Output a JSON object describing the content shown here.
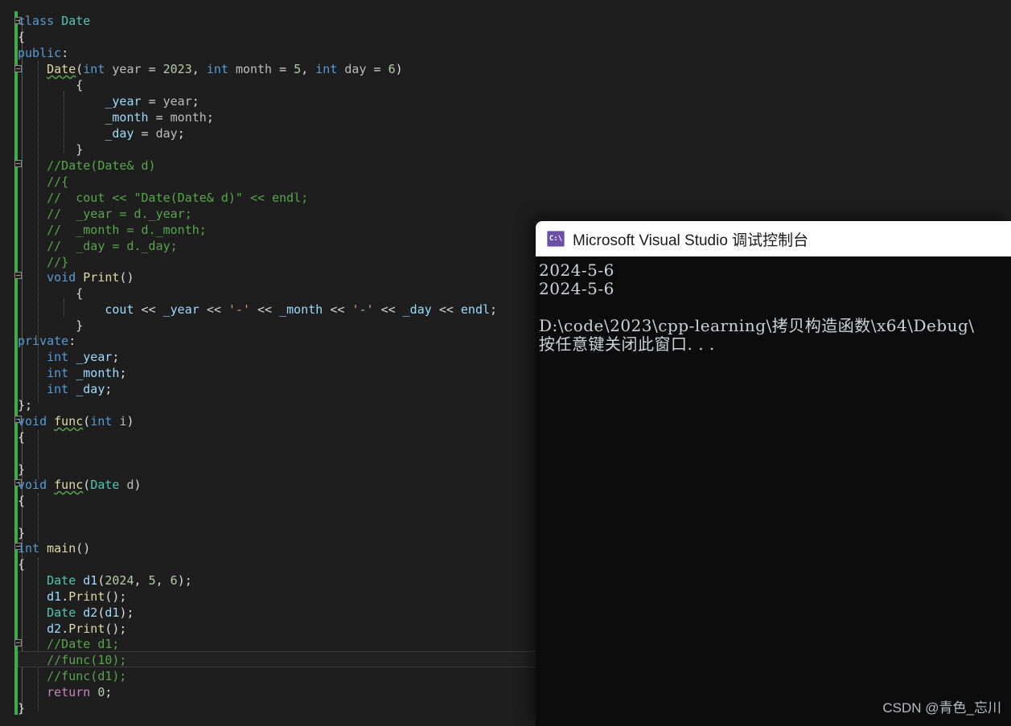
{
  "editor": {
    "background": "#1e1e1e",
    "change_bar_color": "#3fae49",
    "current_line": "//func(10);",
    "lines": [
      "class Date",
      "{",
      "public:",
      "    Date(int year = 2023, int month = 5, int day = 6)",
      "    {",
      "        _year = year;",
      "        _month = month;",
      "        _day = day;",
      "    }",
      "    //Date(Date& d)",
      "    //{",
      "    //  cout << \"Date(Date& d)\" << endl;",
      "    //  _year = d._year;",
      "    //  _month = d._month;",
      "    //  _day = d._day;",
      "    //}",
      "    void Print()",
      "    {",
      "        cout << _year << '-' << _month << '-' << _day << endl;",
      "    }",
      "private:",
      "    int _year;",
      "    int _month;",
      "    int _day;",
      "};",
      "void func(int i)",
      "{",
      "",
      "}",
      "void func(Date d)",
      "{",
      "",
      "}",
      "int main()",
      "{",
      "    Date d1(2024, 5, 6);",
      "    d1.Print();",
      "    Date d2(d1);",
      "    d2.Print();",
      "    //Date d1;",
      "    //func(10);",
      "    //func(d1);",
      "    return 0;",
      "}"
    ]
  },
  "console": {
    "icon": "console-app-icon",
    "icon_label": "C:\\",
    "title": "Microsoft Visual Studio 调试控制台",
    "output_lines": [
      "2024-5-6",
      "2024-5-6",
      "",
      "D:\\code\\2023\\cpp-learning\\拷贝构造函数\\x64\\Debug\\",
      "按任意键关闭此窗口. . ."
    ]
  },
  "watermark": {
    "text": "CSDN @青色_忘川"
  }
}
